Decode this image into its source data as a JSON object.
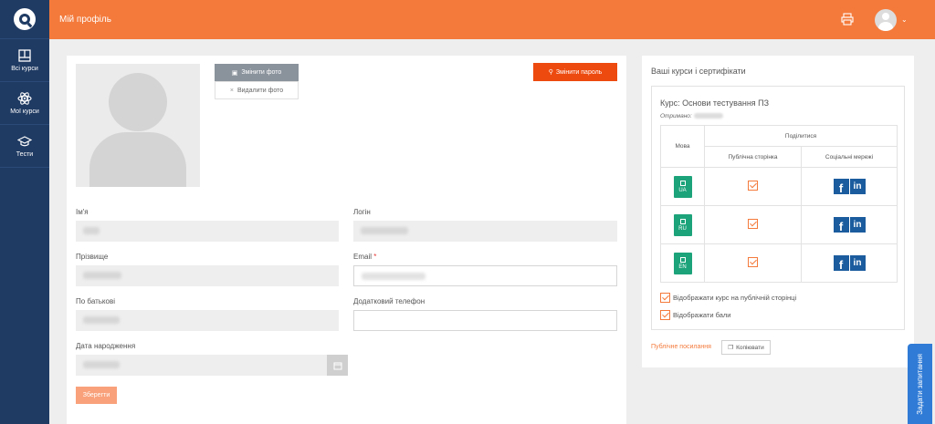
{
  "app": {
    "logo_icon": "logo-icon",
    "accent": "#f47a3b",
    "sidebar_color": "#1f3a63"
  },
  "header": {
    "title": "Мій профіль"
  },
  "sidebar": {
    "items": [
      {
        "label": "Всі курси",
        "icon": "book-icon"
      },
      {
        "label": "Мої курси",
        "icon": "atom-icon"
      },
      {
        "label": "Тести",
        "icon": "graduation-cap-icon"
      }
    ]
  },
  "profile": {
    "change_photo": "Змінити фото",
    "delete_photo": "Видалити фото",
    "change_password": "Змінити пароль",
    "save": "Зберегти",
    "fields": {
      "first_name": {
        "label": "Ім'я"
      },
      "login": {
        "label": "Логін"
      },
      "last_name": {
        "label": "Прізвище"
      },
      "email": {
        "label": "Email",
        "required": "*"
      },
      "middle_name": {
        "label": "По батькові"
      },
      "extra_phone": {
        "label": "Додатковий телефон",
        "value": ""
      },
      "birth_date": {
        "label": "Дата народження"
      }
    }
  },
  "certificates": {
    "title": "Ваші курси і сертифікати",
    "course": "Курс: Основи тестування ПЗ",
    "received_label": "Отримано:",
    "table": {
      "col_lang": "Мова",
      "col_share": "Поділитися",
      "col_public": "Публічна сторінка",
      "col_social": "Соціальні мережі",
      "rows": [
        {
          "lang": "UA",
          "public_checked": true
        },
        {
          "lang": "RU",
          "public_checked": true
        },
        {
          "lang": "EN",
          "public_checked": true
        }
      ]
    },
    "show_on_public": "Відображати курс на публічній сторінці",
    "show_scores": "Відображати бали",
    "public_link": "Публічне посилання",
    "copy": "Копіювати"
  },
  "ask_question": "Задати запитання"
}
